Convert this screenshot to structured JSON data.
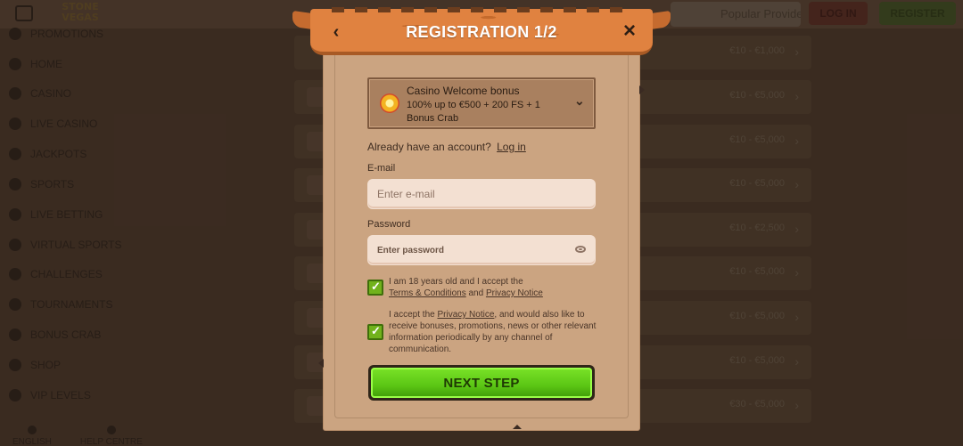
{
  "background": {
    "logo_line1": "STONE",
    "logo_line2": "VEGAS",
    "search_placeholder": "Popular Providers",
    "login_label": "LOG IN",
    "register_label": "REGISTER",
    "nav": [
      {
        "label": "PROMOTIONS",
        "icon": "megaphone-icon"
      },
      {
        "label": "HOME",
        "icon": "home-icon"
      },
      {
        "label": "CASINO",
        "icon": "casino-icon"
      },
      {
        "label": "LIVE CASINO",
        "icon": "live-casino-icon"
      },
      {
        "label": "JACKPOTS",
        "icon": "jackpot-icon"
      },
      {
        "label": "SPORTS",
        "icon": "sports-icon"
      },
      {
        "label": "LIVE BETTING",
        "icon": "live-betting-icon"
      },
      {
        "label": "VIRTUAL SPORTS",
        "icon": "virtual-sports-icon"
      },
      {
        "label": "CHALLENGES",
        "icon": "challenges-icon"
      },
      {
        "label": "TOURNAMENTS",
        "icon": "trophy-icon"
      },
      {
        "label": "BONUS CRAB",
        "icon": "crab-icon"
      },
      {
        "label": "SHOP",
        "icon": "shop-icon"
      },
      {
        "label": "VIP LEVELS",
        "icon": "crown-icon"
      }
    ],
    "footer": [
      {
        "label": "ENGLISH",
        "icon": "flag-icon"
      },
      {
        "label": "HELP CENTRE",
        "icon": "help-icon"
      }
    ],
    "bonus_amounts": [
      "€10 - €1,000",
      "€10 - €5,000",
      "€10 - €5,000",
      "€10 - €5,000",
      "€10 - €2,500",
      "€10 - €5,000",
      "€10 - €5,000",
      "€10 - €5,000",
      "€30 - €5,000"
    ]
  },
  "modal": {
    "title": "REGISTRATION 1/2",
    "back_icon": "chevron-left-icon",
    "close_icon": "close-icon",
    "bonus": {
      "title": "Casino Welcome bonus",
      "description": "100% up to €500 + 200 FS + 1 Bonus Crab"
    },
    "account_text": "Already have an account?",
    "login_link": "Log in",
    "email_label": "E-mail",
    "email_placeholder": "Enter e-mail",
    "password_label": "Password",
    "password_placeholder": "Enter password",
    "terms": {
      "prefix": "I am 18 years old and I accept the",
      "terms_link": "Terms & Conditions",
      "and": "and",
      "privacy_link": "Privacy Notice"
    },
    "marketing": {
      "prefix": "I accept the",
      "privacy_link": "Privacy Notice",
      "suffix": ", and would also like to receive bonuses, promotions, news or other relevant information periodically by any channel of communication."
    },
    "next_label": "NEXT STEP",
    "colors": {
      "accent_green": "#5bc614",
      "banner_orange": "#e08240",
      "panel": "#cba481"
    }
  }
}
